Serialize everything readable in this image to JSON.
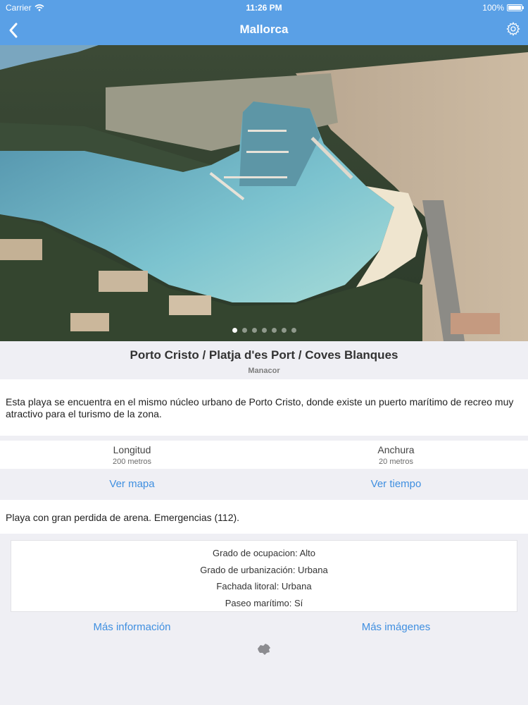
{
  "status": {
    "carrier": "Carrier",
    "time": "11:26 PM",
    "battery": "100%"
  },
  "nav": {
    "title": "Mallorca"
  },
  "carousel": {
    "page_count": 7,
    "active_index": 0
  },
  "beach": {
    "name": "Porto Cristo / Platja d'es Port / Coves Blanques",
    "municipality": "Manacor",
    "description": "Esta playa se encuentra en el mismo núcleo urbano de Porto Cristo, donde existe un puerto marítimo de recreo muy atractivo para el turismo de la zona.",
    "length_label": "Longitud",
    "length_value": "200 metros",
    "width_label": "Anchura",
    "width_value": "20 metros",
    "note": "Playa con gran perdida de arena. Emergencias (112).",
    "stats": [
      "Grado de ocupacion: Alto",
      "Grado de urbanización: Urbana",
      "Fachada litoral: Urbana",
      "Paseo marítimo: Sí"
    ]
  },
  "actions": {
    "map": "Ver mapa",
    "weather": "Ver tiempo",
    "more_info": "Más información",
    "more_images": "Más imágenes"
  },
  "colors": {
    "accent": "#5aa0e6",
    "link": "#3f8fe0"
  },
  "icons": {
    "back": "chevron-left-icon",
    "settings": "gear-icon",
    "footer": "mallorca-island-icon"
  }
}
